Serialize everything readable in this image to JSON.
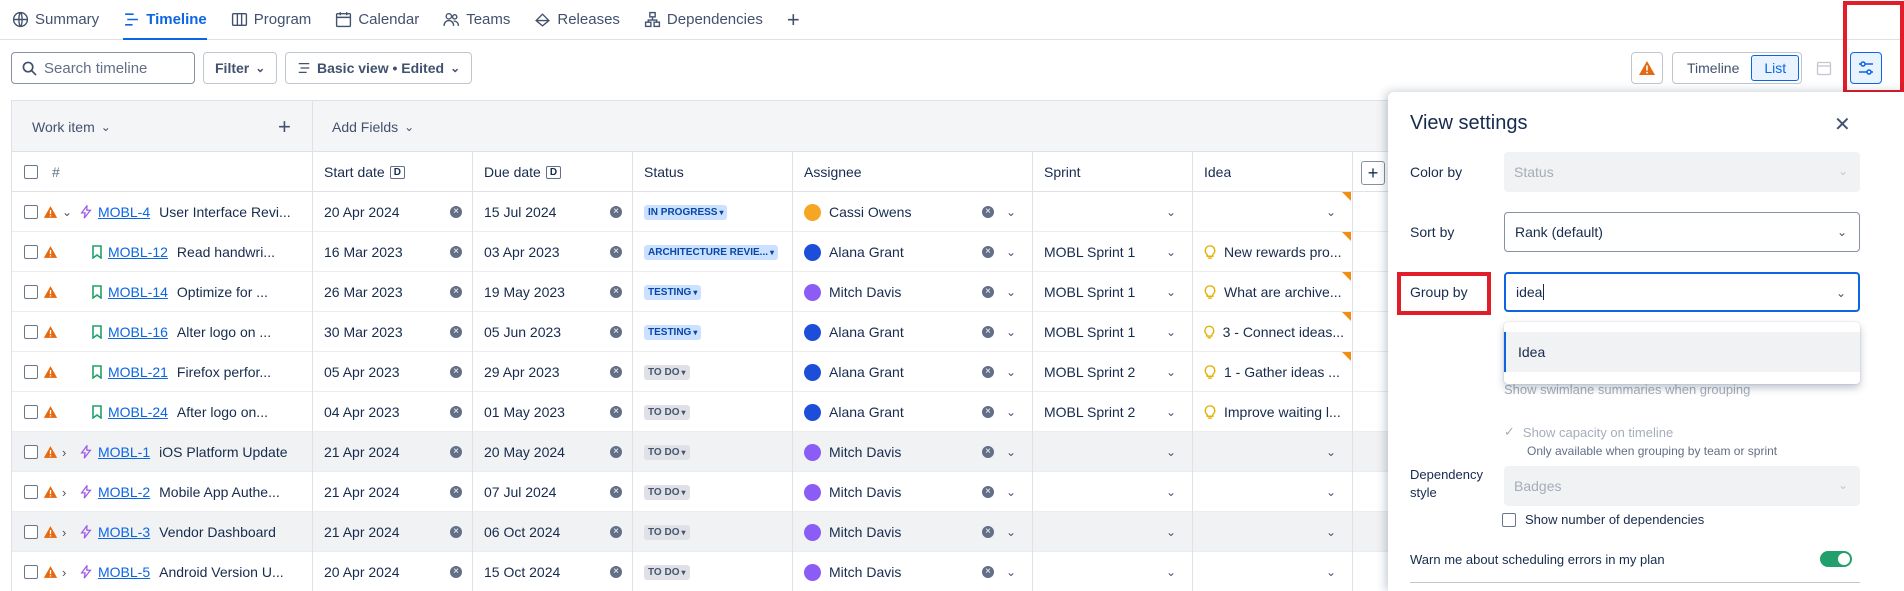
{
  "tabs": [
    {
      "label": "Summary",
      "icon": "globe-icon"
    },
    {
      "label": "Timeline",
      "icon": "timeline-icon",
      "active": true
    },
    {
      "label": "Program",
      "icon": "program-icon"
    },
    {
      "label": "Calendar",
      "icon": "calendar-icon"
    },
    {
      "label": "Teams",
      "icon": "teams-icon"
    },
    {
      "label": "Releases",
      "icon": "releases-icon"
    },
    {
      "label": "Dependencies",
      "icon": "dependencies-icon"
    }
  ],
  "toolbar": {
    "search_placeholder": "Search timeline",
    "filter_label": "Filter",
    "view_label": "Basic view • Edited",
    "view_timeline": "Timeline",
    "view_list": "List"
  },
  "grid": {
    "work_item_label": "Work item",
    "add_fields_label": "Add Fields",
    "columns": {
      "num": "#",
      "start": "Start date",
      "due": "Due date",
      "status": "Status",
      "assignee": "Assignee",
      "sprint": "Sprint",
      "idea": "Idea",
      "date_badge": "D"
    },
    "rows": [
      {
        "key": "MOBL-4",
        "summary": "User Interface Revi...",
        "start": "20 Apr 2024",
        "due": "15 Jul 2024",
        "status": "IN PROGRESS",
        "status_kind": "prog",
        "assignee": "Cassi Owens",
        "avatar_color": "#f5a623",
        "sprint": "",
        "idea": "",
        "type": "epic",
        "expand": "down",
        "corner": true,
        "sel": false
      },
      {
        "key": "MOBL-12",
        "summary": "Read handwri...",
        "start": "16 Mar 2023",
        "due": "03 Apr 2023",
        "status": "ARCHITECTURE REVIE...",
        "status_kind": "arch",
        "assignee": "Alana Grant",
        "avatar_color": "#1d4ed8",
        "sprint": "MOBL Sprint 1",
        "idea": "New rewards pro...",
        "type": "story",
        "expand": "",
        "corner": true,
        "sel": false
      },
      {
        "key": "MOBL-14",
        "summary": "Optimize for ...",
        "start": "26 Mar 2023",
        "due": "19 May 2023",
        "status": "TESTING",
        "status_kind": "test",
        "assignee": "Mitch Davis",
        "avatar_color": "#8b5cf6",
        "sprint": "MOBL Sprint 1",
        "idea": "What are archive...",
        "type": "story",
        "expand": "",
        "corner": true,
        "sel": false
      },
      {
        "key": "MOBL-16",
        "summary": "Alter logo on ...",
        "start": "30 Mar 2023",
        "due": "05 Jun 2023",
        "status": "TESTING",
        "status_kind": "test",
        "assignee": "Alana Grant",
        "avatar_color": "#1d4ed8",
        "sprint": "MOBL Sprint 1",
        "idea": "3 - Connect ideas...",
        "type": "story",
        "expand": "",
        "corner": true,
        "sel": false
      },
      {
        "key": "MOBL-21",
        "summary": "Firefox perfor...",
        "start": "05 Apr 2023",
        "due": "29 Apr 2023",
        "status": "TO DO",
        "status_kind": "todo",
        "assignee": "Alana Grant",
        "avatar_color": "#1d4ed8",
        "sprint": "MOBL Sprint 2",
        "idea": "1 - Gather ideas ...",
        "type": "story",
        "expand": "",
        "corner": true,
        "sel": false
      },
      {
        "key": "MOBL-24",
        "summary": "After logo on...",
        "start": "04 Apr 2023",
        "due": "01 May 2023",
        "status": "TO DO",
        "status_kind": "todo",
        "assignee": "Alana Grant",
        "avatar_color": "#1d4ed8",
        "sprint": "MOBL Sprint 2",
        "idea": "Improve waiting l...",
        "type": "story",
        "expand": "",
        "corner": false,
        "sel": false
      },
      {
        "key": "MOBL-1",
        "summary": "iOS Platform Update",
        "start": "21 Apr 2024",
        "due": "20 May 2024",
        "status": "TO DO",
        "status_kind": "todo",
        "assignee": "Mitch Davis",
        "avatar_color": "#8b5cf6",
        "sprint": "",
        "idea": "",
        "type": "epic",
        "expand": "right",
        "corner": false,
        "sel": true
      },
      {
        "key": "MOBL-2",
        "summary": "Mobile App Authe...",
        "start": "21 Apr 2024",
        "due": "07 Jul 2024",
        "status": "TO DO",
        "status_kind": "todo",
        "assignee": "Mitch Davis",
        "avatar_color": "#8b5cf6",
        "sprint": "",
        "idea": "",
        "type": "epic",
        "expand": "right",
        "corner": false,
        "sel": false
      },
      {
        "key": "MOBL-3",
        "summary": "Vendor Dashboard",
        "start": "21 Apr 2024",
        "due": "06 Oct 2024",
        "status": "TO DO",
        "status_kind": "todo",
        "assignee": "Mitch Davis",
        "avatar_color": "#8b5cf6",
        "sprint": "",
        "idea": "",
        "type": "epic",
        "expand": "right",
        "corner": false,
        "sel": true
      },
      {
        "key": "MOBL-5",
        "summary": "Android Version U...",
        "start": "20 Apr 2024",
        "due": "15 Oct 2024",
        "status": "TO DO",
        "status_kind": "todo",
        "assignee": "Mitch Davis",
        "avatar_color": "#8b5cf6",
        "sprint": "",
        "idea": "",
        "type": "epic",
        "expand": "right",
        "corner": false,
        "sel": false
      }
    ]
  },
  "panel": {
    "title": "View settings",
    "color_by_label": "Color by",
    "color_by_value": "Status",
    "sort_by_label": "Sort by",
    "sort_by_value": "Rank (default)",
    "group_by_label": "Group by",
    "group_by_value": "idea",
    "group_option": "Idea",
    "swimlane_text": "Show swimlane summaries when grouping",
    "capacity_text": "Show capacity on timeline",
    "capacity_note": "Only available when grouping by team or sprint",
    "dependency_label_1": "Dependency",
    "dependency_label_2": "style",
    "dependency_value": "Badges",
    "show_deps_label": "Show number of dependencies",
    "warn_label": "Warn me about scheduling errors in my plan"
  },
  "colors": {
    "accent": "#0c66e4",
    "highlight": "#e11d2a",
    "warning": "#f18d13",
    "toggle_on": "#22a06b"
  }
}
